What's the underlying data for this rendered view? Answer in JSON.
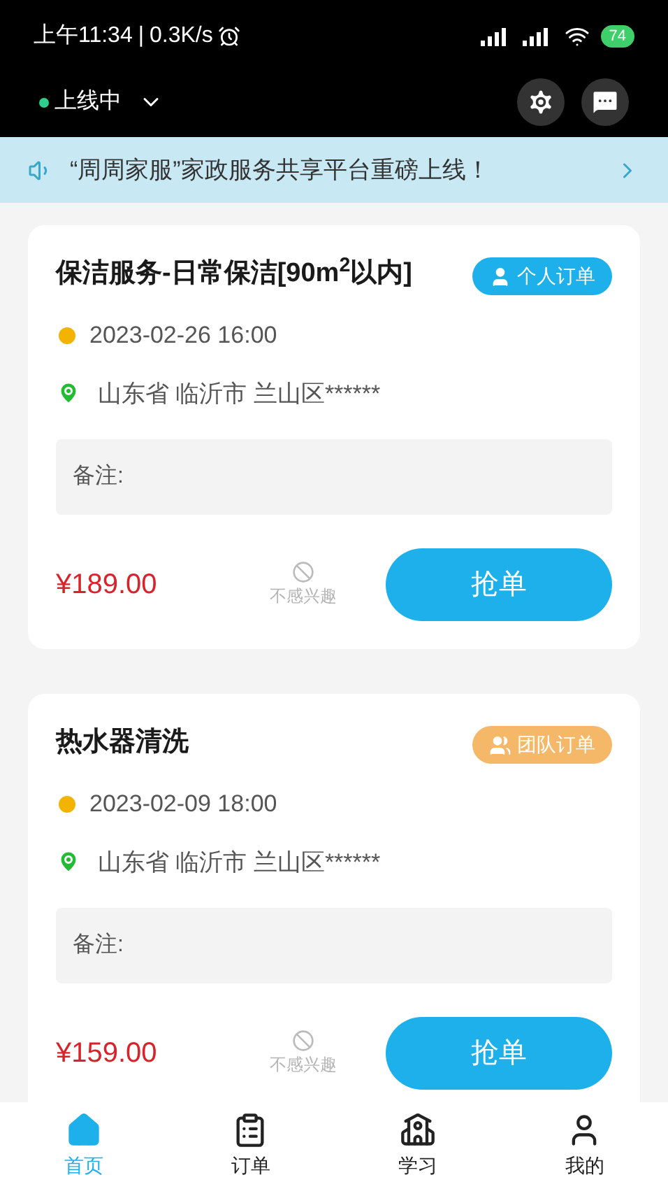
{
  "status_bar": {
    "time": "上午11:34",
    "separator": "|",
    "speed": "0.3K/s",
    "battery": "74"
  },
  "header": {
    "status": "上线中"
  },
  "notice": {
    "text": "“周周家服”家政服务共享平台重磅上线！"
  },
  "orders": [
    {
      "title": "保洁服务-日常保洁[90m$^{2}$以内]",
      "badge": "个人订单",
      "kind": "personal",
      "time": "2023-02-26 16:00",
      "address": "山东省 临沂市 兰山区******",
      "note_label": "备注:",
      "price": "¥189.00",
      "dismiss": "不感兴趣",
      "action": "抢单"
    },
    {
      "title": "热水器清洗",
      "badge": "团队订单",
      "kind": "team",
      "time": "2023-02-09 18:00",
      "address": "山东省 临沂市 兰山区******",
      "note_label": "备注:",
      "price": "¥159.00",
      "dismiss": "不感兴趣",
      "action": "抢单"
    }
  ],
  "tabs": [
    {
      "label": "首页",
      "selected": true
    },
    {
      "label": "订单",
      "selected": false
    },
    {
      "label": "学习",
      "selected": false
    },
    {
      "label": "我的",
      "selected": false
    }
  ]
}
